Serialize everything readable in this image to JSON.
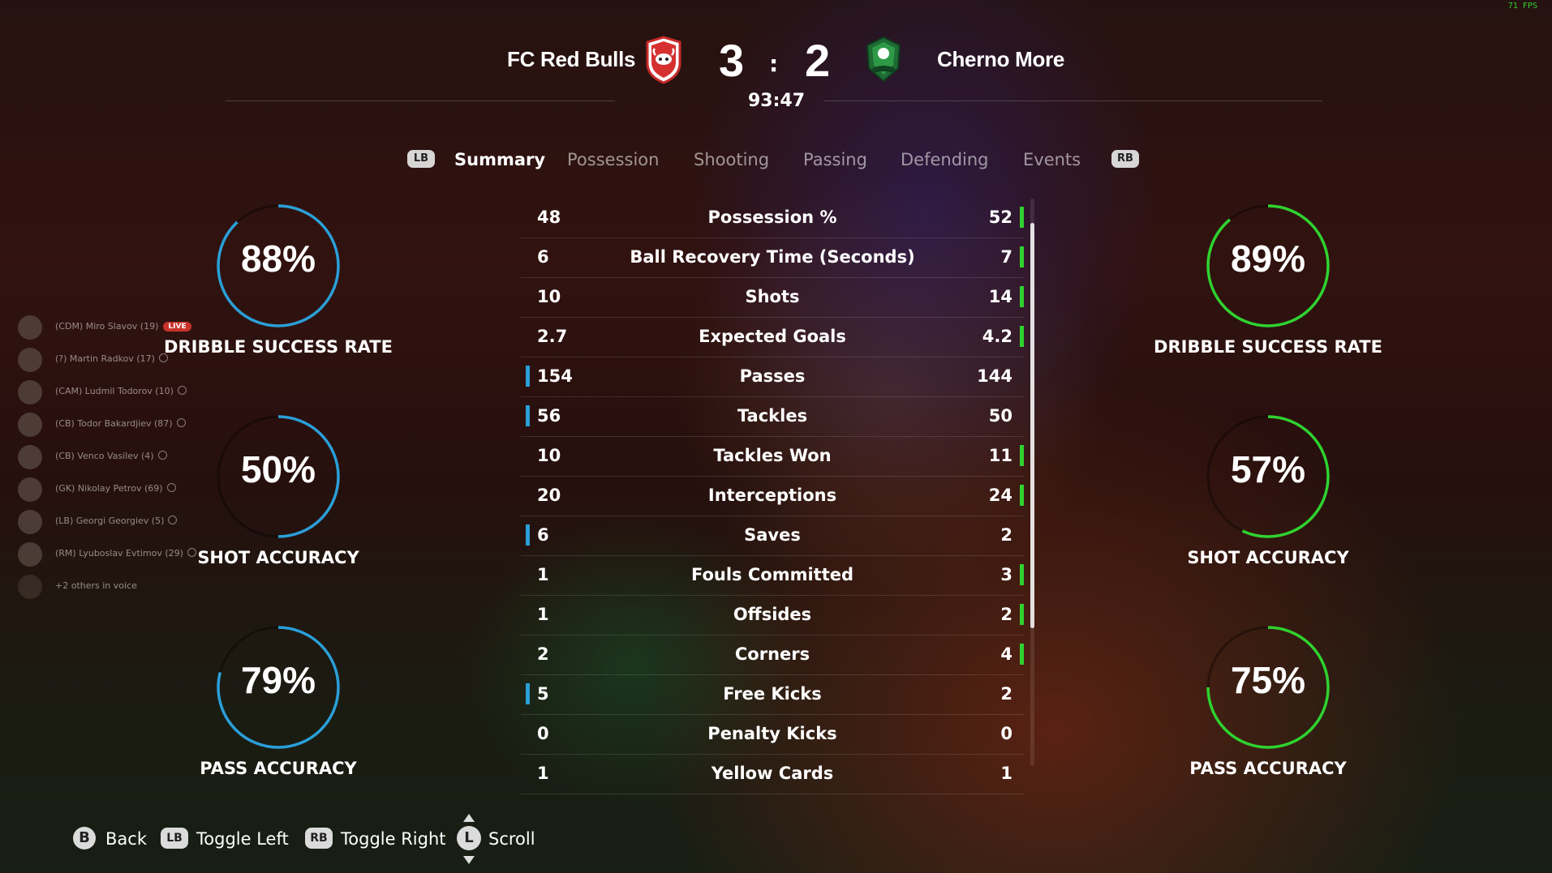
{
  "fps": "71 FPS",
  "match": {
    "home_team": "FC Red Bulls",
    "away_team": "Cherno More",
    "home_score": "3",
    "away_score": "2",
    "separator": ":",
    "clock": "93:47"
  },
  "colors": {
    "home_accent": "#2a9fd8",
    "away_accent": "#2fd22f",
    "live_badge": "#c8322a"
  },
  "tabs": {
    "left_button": "LB",
    "right_button": "RB",
    "items": [
      "Summary",
      "Possession",
      "Shooting",
      "Passing",
      "Defending",
      "Events"
    ],
    "active": "Summary"
  },
  "stats": [
    {
      "name": "Possession %",
      "home": "48",
      "away": "52",
      "leader": "away"
    },
    {
      "name": "Ball Recovery Time (Seconds)",
      "home": "6",
      "away": "7",
      "leader": "away"
    },
    {
      "name": "Shots",
      "home": "10",
      "away": "14",
      "leader": "away"
    },
    {
      "name": "Expected Goals",
      "home": "2.7",
      "away": "4.2",
      "leader": "away"
    },
    {
      "name": "Passes",
      "home": "154",
      "away": "144",
      "leader": "home"
    },
    {
      "name": "Tackles",
      "home": "56",
      "away": "50",
      "leader": "home"
    },
    {
      "name": "Tackles Won",
      "home": "10",
      "away": "11",
      "leader": "away"
    },
    {
      "name": "Interceptions",
      "home": "20",
      "away": "24",
      "leader": "away"
    },
    {
      "name": "Saves",
      "home": "6",
      "away": "2",
      "leader": "home"
    },
    {
      "name": "Fouls Committed",
      "home": "1",
      "away": "3",
      "leader": "away"
    },
    {
      "name": "Offsides",
      "home": "1",
      "away": "2",
      "leader": "away"
    },
    {
      "name": "Corners",
      "home": "2",
      "away": "4",
      "leader": "away"
    },
    {
      "name": "Free Kicks",
      "home": "5",
      "away": "2",
      "leader": "home"
    },
    {
      "name": "Penalty Kicks",
      "home": "0",
      "away": "0",
      "leader": "none"
    },
    {
      "name": "Yellow Cards",
      "home": "1",
      "away": "1",
      "leader": "none"
    }
  ],
  "home_gauges": [
    {
      "value": 0.88,
      "text": "88%",
      "label": "DRIBBLE SUCCESS RATE"
    },
    {
      "value": 0.5,
      "text": "50%",
      "label": "SHOT ACCURACY"
    },
    {
      "value": 0.79,
      "text": "79%",
      "label": "PASS ACCURACY"
    }
  ],
  "away_gauges": [
    {
      "value": 0.89,
      "text": "89%",
      "label": "DRIBBLE SUCCESS RATE"
    },
    {
      "value": 0.57,
      "text": "57%",
      "label": "SHOT ACCURACY"
    },
    {
      "value": 0.75,
      "text": "75%",
      "label": "PASS ACCURACY"
    }
  ],
  "voice": {
    "live_label": "LIVE",
    "members": [
      {
        "name": "(CDM) Miro Slavov (19)",
        "live": true
      },
      {
        "name": "(?) Martin Radkov (17)",
        "live": false
      },
      {
        "name": "(CAM) Ludmil Todorov (10)",
        "live": false
      },
      {
        "name": "(CB) Todor Bakardjiev (87)",
        "live": false
      },
      {
        "name": "(CB) Venco Vasilev (4)",
        "live": false
      },
      {
        "name": "(GK) Nikolay Petrov (69)",
        "live": false
      },
      {
        "name": "(LB) Georgi Georgiev (5)",
        "live": false
      },
      {
        "name": "(RM) Lyuboslav Evtimov (29)",
        "live": false
      }
    ],
    "others": "+2 others in voice"
  },
  "footer": {
    "back_btn": "B",
    "back": "Back",
    "toggle_left_btn": "LB",
    "toggle_left": "Toggle Left",
    "toggle_right_btn": "RB",
    "toggle_right": "Toggle Right",
    "scroll_btn": "L",
    "scroll": "Scroll"
  }
}
